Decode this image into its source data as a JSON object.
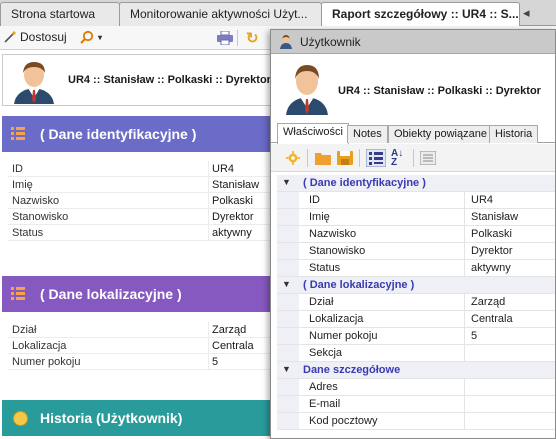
{
  "tabs": [
    {
      "label": "Strona startowa"
    },
    {
      "label": "Monitorowanie aktywności Użyt..."
    },
    {
      "label": "Raport szczegółowy  ::  UR4 :: S..."
    }
  ],
  "toolbar": {
    "customize_label": "Dostosuj",
    "search_icon": "magnifier-icon",
    "print_icon": "printer-icon",
    "refresh_icon": "refresh-icon"
  },
  "report": {
    "header_title": "UR4 :: Stanisław :: Polkaski :: Dyrektor",
    "sections": {
      "ident": {
        "title": "( Dane identyfikacyjne )",
        "rows": [
          {
            "key": "ID",
            "value": "UR4"
          },
          {
            "key": "Imię",
            "value": "Stanisław"
          },
          {
            "key": "Nazwisko",
            "value": "Polkaski"
          },
          {
            "key": "Stanowisko",
            "value": "Dyrektor"
          },
          {
            "key": "Status",
            "value": "aktywny"
          }
        ]
      },
      "lok": {
        "title": "( Dane lokalizacyjne )",
        "rows": [
          {
            "key": "Dział",
            "value": "Zarząd"
          },
          {
            "key": "Lokalizacja",
            "value": "Centrala"
          },
          {
            "key": "Numer pokoju",
            "value": "5"
          }
        ]
      },
      "hist": {
        "title": "Historia (Użytkownik)"
      }
    },
    "colors": {
      "ident": "#6b6bc8",
      "lok": "#8659c0",
      "hist": "#2a9b9b"
    }
  },
  "window": {
    "title": "Użytkownik",
    "header_name": "UR4 :: Stanisław :: Polkaski :: Dyrektor",
    "tabs": [
      {
        "label": "Właściwości",
        "active": true
      },
      {
        "label": "Notes"
      },
      {
        "label": "Obiekty powiązane"
      },
      {
        "label": "Historia"
      }
    ],
    "grid": {
      "cat_ident": "( Dane identyfikacyjne )",
      "ident_rows": [
        {
          "key": "ID",
          "value": "UR4"
        },
        {
          "key": "Imię",
          "value": "Stanisław"
        },
        {
          "key": "Nazwisko",
          "value": "Polkaski"
        },
        {
          "key": "Stanowisko",
          "value": "Dyrektor"
        },
        {
          "key": "Status",
          "value": "aktywny"
        }
      ],
      "cat_lok": "( Dane lokalizacyjne )",
      "lok_rows": [
        {
          "key": "Dział",
          "value": "Zarząd"
        },
        {
          "key": "Lokalizacja",
          "value": "Centrala"
        },
        {
          "key": "Numer pokoju",
          "value": "5"
        },
        {
          "key": "Sekcja",
          "value": ""
        }
      ],
      "cat_detail": "Dane szczegółowe",
      "detail_rows": [
        {
          "key": "Adres",
          "value": ""
        },
        {
          "key": "E-mail",
          "value": ""
        },
        {
          "key": "Kod pocztowy",
          "value": ""
        }
      ]
    }
  }
}
